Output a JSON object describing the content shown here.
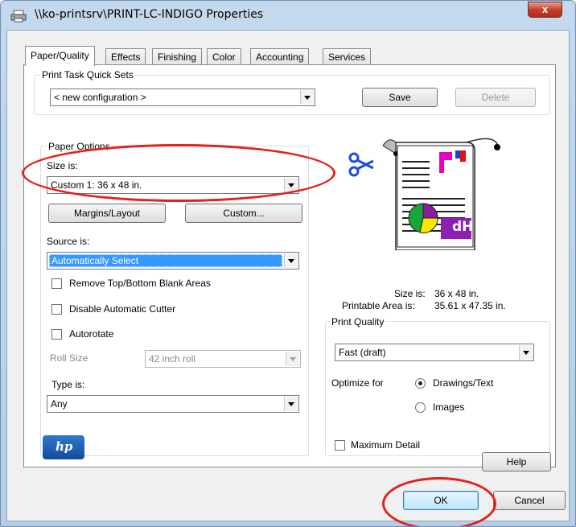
{
  "window": {
    "title": "\\\\ko-printsrv\\PRINT-LC-INDIGO Properties",
    "close_label": "x"
  },
  "tabs": [
    "Paper/Quality",
    "Effects",
    "Finishing",
    "Color",
    "Accounting",
    "Services"
  ],
  "quick_sets": {
    "legend": "Print Task Quick Sets",
    "value": "< new configuration >",
    "save_label": "Save",
    "delete_label": "Delete"
  },
  "paper_options": {
    "legend": "Paper Options",
    "size_label": "Size is:",
    "size_value": "Custom 1:  36  x  48 in.",
    "margins_label": "Margins/Layout",
    "custom_label": "Custom...",
    "source_label": "Source is:",
    "source_value": "Automatically Select",
    "remove_blank_label": "Remove Top/Bottom Blank Areas",
    "disable_cutter_label": "Disable Automatic Cutter",
    "autorotate_label": "Autorotate",
    "roll_size_label": "Roll Size",
    "roll_size_value": "42 inch roll",
    "type_label": "Type is:",
    "type_value": "Any"
  },
  "preview": {
    "size_label": "Size is:",
    "size_value": "36  x  48 in.",
    "printable_label": "Printable Area is:",
    "printable_value": "35.61  x  47.35 in.",
    "logo_text": "dH"
  },
  "print_quality": {
    "legend": "Print Quality",
    "value": "Fast (draft)",
    "optimize_label": "Optimize for",
    "drawings_label": "Drawings/Text",
    "images_label": "Images",
    "max_detail_label": "Maximum Detail"
  },
  "footer": {
    "hp_logo": "hp",
    "help_label": "Help",
    "ok_label": "OK",
    "cancel_label": "Cancel"
  }
}
